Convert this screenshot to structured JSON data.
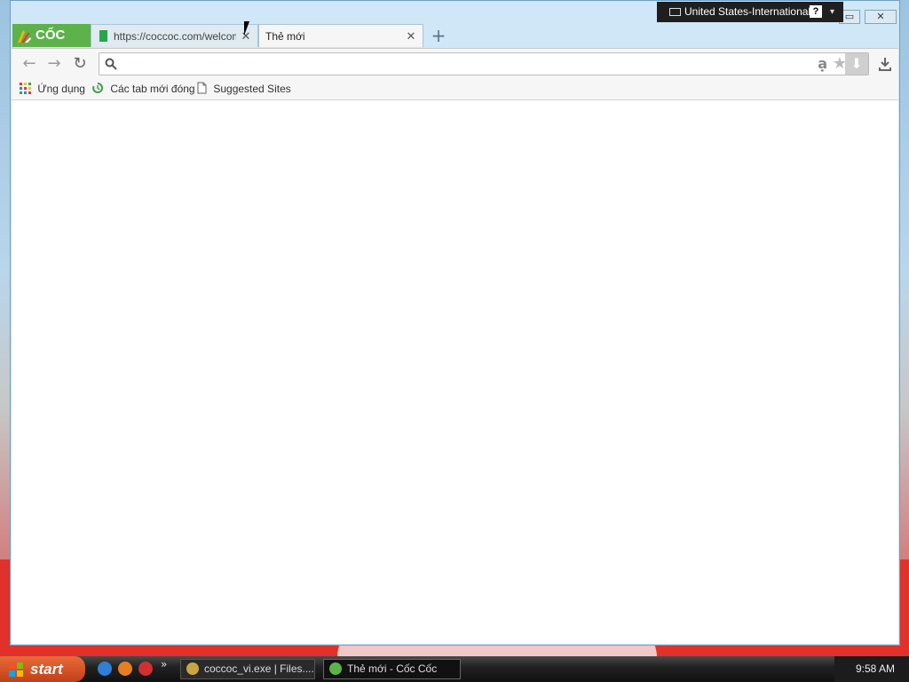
{
  "browser": {
    "logo_text": "CỐC CỐC",
    "tabs": [
      {
        "title": "https://coccoc.com/welcome",
        "active": false
      },
      {
        "title": "Thẻ mới",
        "active": true
      }
    ],
    "tab_close_glyph": "✕",
    "new_tab_glyph": "+",
    "toolbar": {
      "back_glyph": "←",
      "forward_glyph": "→",
      "reload_glyph": "↻",
      "omnibox_value": "",
      "omnibox_translate_glyph": "ạ",
      "star_glyph": "★",
      "download_glyph": "⬇"
    },
    "bookmarks": [
      {
        "label": "Ứng dụng",
        "icon": "apps-grid-icon"
      },
      {
        "label": "Các tab mới đóng",
        "icon": "recent-tabs-icon"
      },
      {
        "label": "Suggested Sites",
        "icon": "page-icon"
      }
    ]
  },
  "language_bar": {
    "language": "United States-International",
    "help_glyph": "?"
  },
  "taskbar": {
    "start_label": "start",
    "overflow_glyph": "»",
    "tasks": [
      {
        "label": "coccoc_vi.exe | Files....",
        "active": false
      },
      {
        "label": "Thẻ mới - Cốc Cốc",
        "active": true
      }
    ],
    "clock": "9:58 AM"
  },
  "colors": {
    "coccoc_green": "#5db24a",
    "start_orange": "#d9552a",
    "window_frame": "#cfe7f7"
  }
}
